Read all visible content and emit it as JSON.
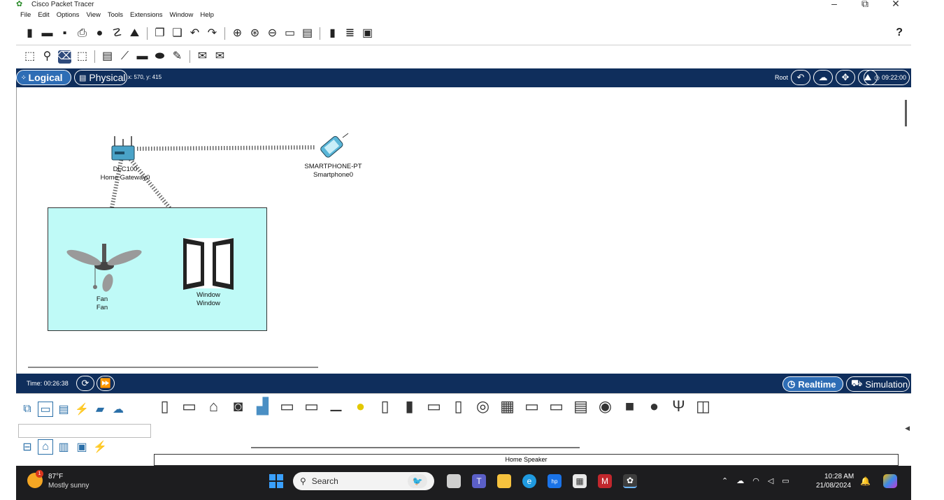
{
  "window": {
    "title": "Cisco Packet Tracer",
    "controls": [
      "–",
      "⧉",
      "✕"
    ]
  },
  "menu": [
    "File",
    "Edit",
    "Options",
    "View",
    "Tools",
    "Extensions",
    "Window",
    "Help"
  ],
  "toolbar": {
    "help": "?"
  },
  "logical_bar": {
    "logical_label": "Logical",
    "physical_label": "Physical",
    "coords": "x: 570, y: 415",
    "root_label": "Root",
    "clock": "09:22:00"
  },
  "workspace": {
    "devices": {
      "gateway": {
        "model": "DLC100",
        "name": "Home Gateway0"
      },
      "smartphone": {
        "model": "SMARTPHONE-PT",
        "name": "Smartphone0"
      },
      "fan": {
        "model": "Fan",
        "name": "Fan"
      },
      "window": {
        "model": "Window",
        "name": "Window"
      }
    }
  },
  "time_bar": {
    "time": "Time: 00:26:38",
    "realtime_label": "Realtime",
    "simulation_label": "Simulation"
  },
  "device_panel": {
    "selected_device": "Home Speaker"
  },
  "taskbar": {
    "temperature": "87°F",
    "condition": "Mostly sunny",
    "notification_count": "1",
    "search_placeholder": "Search",
    "time": "10:28 AM",
    "date": "21/08/2024"
  }
}
